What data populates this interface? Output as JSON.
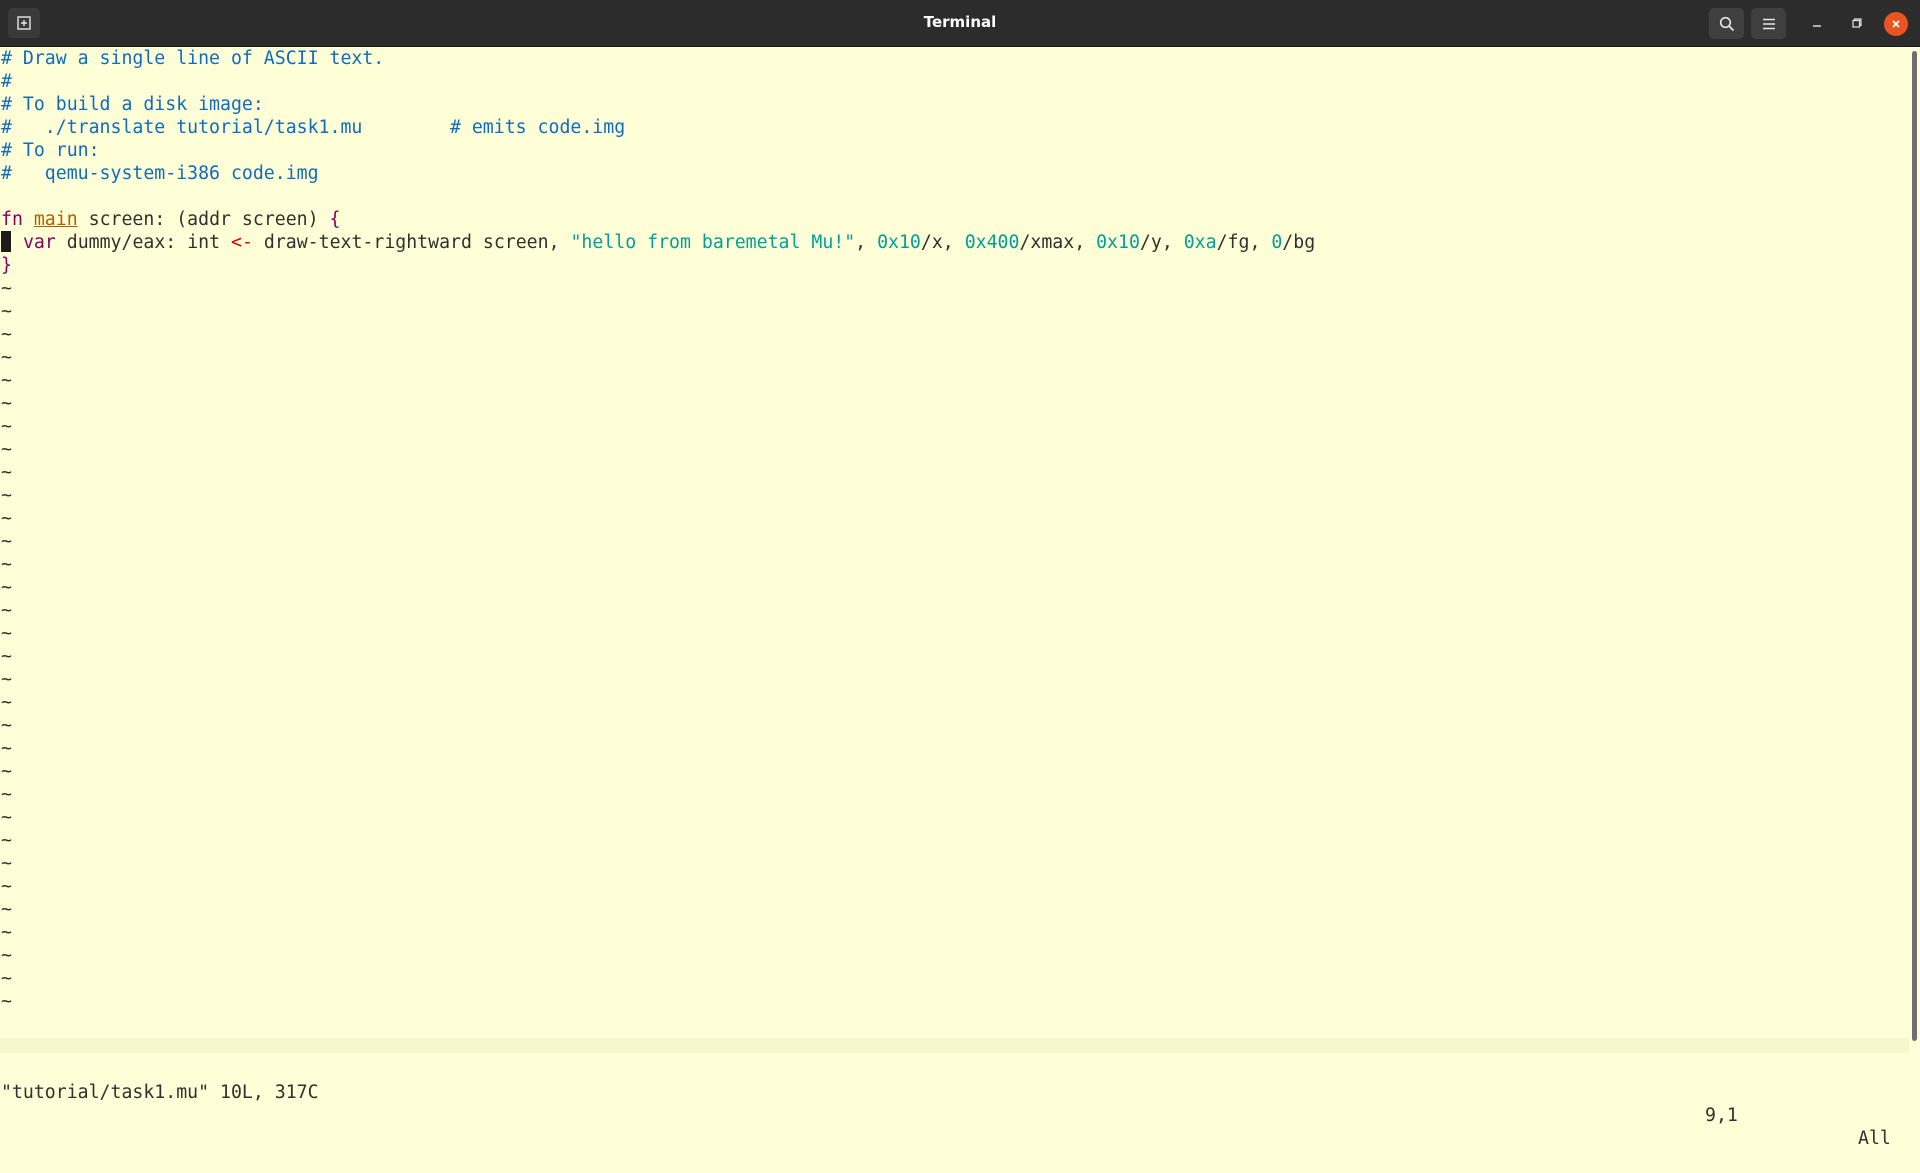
{
  "window": {
    "title": "Terminal"
  },
  "colors": {
    "titlebar_bg": "#2c2c2c",
    "terminal_bg": "#ffffd7",
    "comment": "#0e6bbf",
    "keyword": "#87005f",
    "string": "#00a09a",
    "operator": "#d70000",
    "close_button": "#e95420"
  },
  "icons": {
    "new_tab": "new-tab-icon",
    "search": "search-icon",
    "menu": "hamburger-menu-icon",
    "minimize": "minimize-icon",
    "maximize": "maximize-icon",
    "close": "close-icon"
  },
  "editor": {
    "comments": [
      "# Draw a single line of ASCII text.",
      "#",
      "# To build a disk image:",
      "#   ./translate tutorial/task1.mu        # emits code.img",
      "# To run:",
      "#   qemu-system-i386 code.img"
    ],
    "fn_line": {
      "keyword": "fn",
      "name": "main",
      "params": " screen: (addr screen) ",
      "open_brace": "{"
    },
    "var_line": {
      "keyword": "var",
      "decl": " dummy/eax: int ",
      "arrow": "<-",
      "call": " draw-text-rightward screen, ",
      "string": "\"hello from baremetal Mu!\"",
      "sep1": ", ",
      "n1": "0x10",
      "a1": "/x, ",
      "n2": "0x400",
      "a2": "/xmax, ",
      "n3": "0x10",
      "a3": "/y, ",
      "n4": "0xa",
      "a4": "/fg, ",
      "n5": "0",
      "a5": "/bg"
    },
    "close_brace": "}",
    "tilde": "~",
    "tilde_count": 32
  },
  "status": {
    "file": "\"tutorial/task1.mu\" 10L, 317C",
    "position": "9,1",
    "scroll": "All"
  }
}
